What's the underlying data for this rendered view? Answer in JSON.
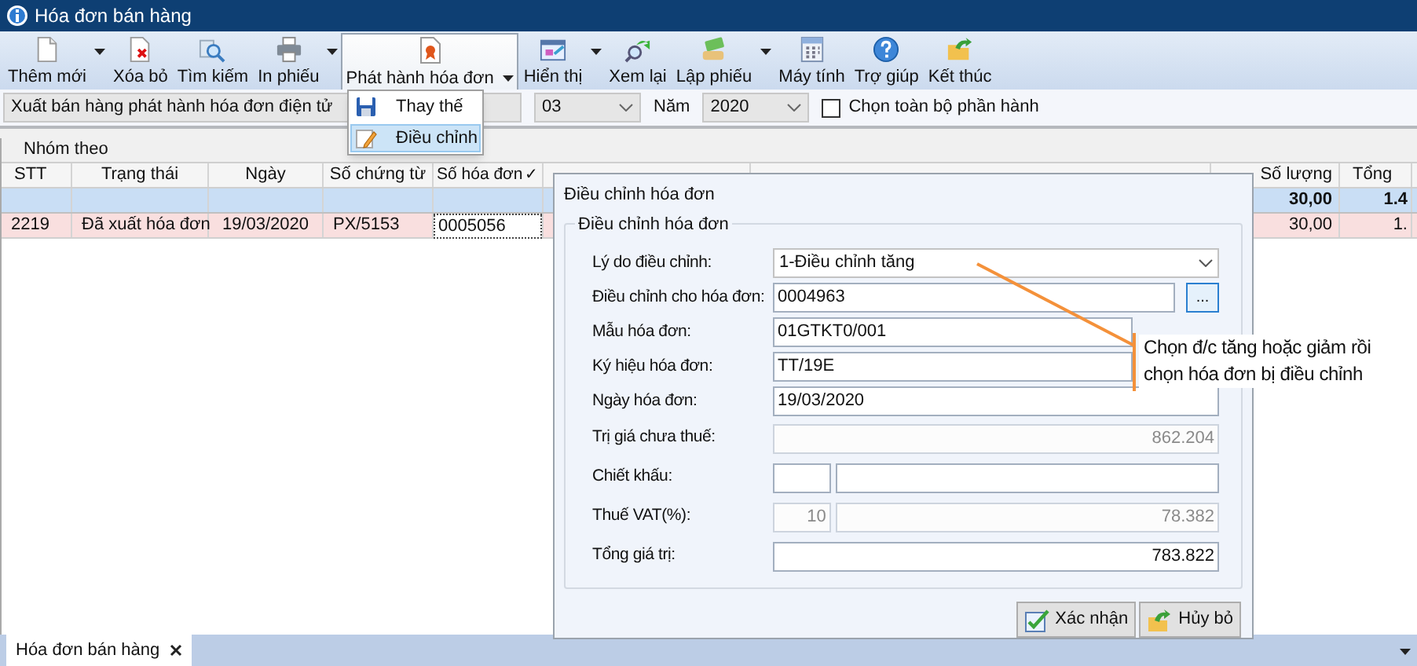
{
  "window": {
    "title": "Hóa đơn bán hàng"
  },
  "toolbar": [
    {
      "label": "Thêm mới",
      "kind": "new",
      "has_menu": true,
      "pressed": false
    },
    {
      "label": "Xóa bỏ",
      "kind": "delete",
      "has_menu": false,
      "pressed": false
    },
    {
      "label": "Tìm kiếm",
      "kind": "search",
      "has_menu": false,
      "pressed": false
    },
    {
      "label": "In phiếu",
      "kind": "print",
      "has_menu": true,
      "pressed": false
    },
    {
      "label": "Phát hành hóa đơn",
      "kind": "issue",
      "has_menu": true,
      "pressed": true
    },
    {
      "label": "Hiển thị",
      "kind": "view",
      "has_menu": true,
      "pressed": false
    },
    {
      "label": "Xem lại",
      "kind": "review",
      "has_menu": false,
      "pressed": false
    },
    {
      "label": "Lập phiếu",
      "kind": "voucher",
      "has_menu": true,
      "pressed": false
    },
    {
      "label": "Máy tính",
      "kind": "calculator",
      "has_menu": false,
      "pressed": false
    },
    {
      "label": "Trợ giúp",
      "kind": "help",
      "has_menu": false,
      "pressed": false
    },
    {
      "label": "Kết thúc",
      "kind": "exit",
      "has_menu": false,
      "pressed": false
    }
  ],
  "dropdown_menu": [
    {
      "label": "Thay thế",
      "kind": "replace",
      "selected": false
    },
    {
      "label": "Điều chỉnh",
      "kind": "adjust",
      "selected": true
    }
  ],
  "filter": {
    "voucher_type": "Xuất bán hàng phát hành hóa đơn điện tử",
    "month": "03",
    "year_label": "Năm",
    "year": "2020",
    "select_all": {
      "label": "Chọn toàn bộ phần hành",
      "checked": false
    }
  },
  "grid": {
    "group_label": "Nhóm theo",
    "columns_left": [
      {
        "label": "STT"
      },
      {
        "label": "Trạng thái"
      },
      {
        "label": "Ngày"
      },
      {
        "label": "Số chứng từ"
      },
      {
        "label": "Số hóa đơn",
        "sort_mark": "✓"
      }
    ],
    "columns_right": [
      {
        "label": "Số lượng"
      },
      {
        "label": "Tổng"
      }
    ],
    "summary_row": {
      "quantity": "30,00",
      "total": "1.4"
    },
    "rows": [
      {
        "cells": [
          "2219",
          "Đã xuất hóa đơn",
          "19/03/2020",
          "PX/5153",
          "0005056"
        ],
        "quantity": "30,00",
        "total": "1.",
        "selected": true
      }
    ]
  },
  "dialog": {
    "title": "Điều chỉnh hóa đơn",
    "group_title": "Điều chỉnh hóa đơn",
    "fields": [
      {
        "label": "Lý do điều chỉnh:",
        "kind": "select",
        "value": "1-Điều chỉnh tăng",
        "disabled": false
      },
      {
        "label": "Điều chỉnh cho hóa đơn:",
        "kind": "lookup",
        "value": "0004963",
        "button": "...",
        "disabled": false
      },
      {
        "label": "Mẫu hóa đơn:",
        "kind": "text",
        "value": "01GTKT0/001",
        "disabled": false
      },
      {
        "label": "Ký hiệu hóa đơn:",
        "kind": "text",
        "value": "TT/19E",
        "disabled": false
      },
      {
        "label": "Ngày hóa đơn:",
        "kind": "text",
        "value": "19/03/2020",
        "disabled": false
      },
      {
        "label": "Trị giá chưa thuế:",
        "kind": "number",
        "value": "862.204",
        "disabled": true
      },
      {
        "label": "Chiết khấu:",
        "kind": "pair",
        "disabled": false
      },
      {
        "label": "Thuế VAT(%):",
        "kind": "pair",
        "values": [
          "10",
          "78.382"
        ],
        "disabled": true
      },
      {
        "label": "Tổng giá trị:",
        "kind": "number",
        "value": "783.822",
        "disabled": false
      }
    ],
    "buttons": [
      {
        "label": "Xác nhận",
        "kind": "confirm"
      },
      {
        "label": "Hủy bỏ",
        "kind": "cancel"
      }
    ]
  },
  "annotation": {
    "text": "Chọn đ/c tăng hoặc giảm rồi chọn hóa đơn bị điều chỉnh"
  },
  "tabs": [
    {
      "label": "Hóa đơn bán hàng",
      "selected": true
    }
  ]
}
